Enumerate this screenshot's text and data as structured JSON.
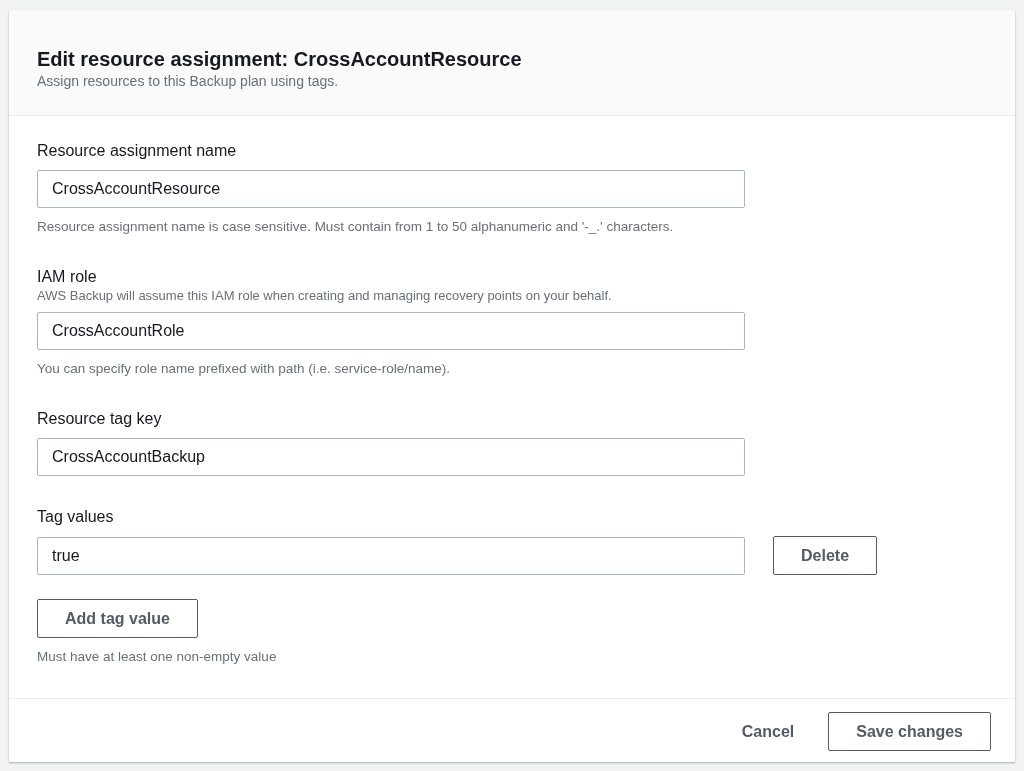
{
  "dialog": {
    "title": "Edit resource assignment: CrossAccountResource",
    "description": "Assign resources to this Backup plan using tags."
  },
  "fields": [
    {
      "label": "Resource assignment name",
      "value": "CrossAccountResource",
      "hint": "Resource assignment name is case sensitive. Must contain from 1 to 50 alphanumeric and '-_.' characters."
    },
    {
      "label": "IAM role",
      "description": "AWS Backup will assume this IAM role when creating and managing recovery points on your behalf.",
      "value": "CrossAccountRole",
      "hint": "You can specify role name prefixed with path (i.e. service-role/name)."
    },
    {
      "label": "Resource tag key",
      "value": "CrossAccountBackup"
    }
  ],
  "tag_values": {
    "label": "Tag values",
    "items": [
      {
        "value": "true",
        "remove_button": "Delete"
      }
    ],
    "add_button": "Add tag value",
    "hint": "Must have at least one non-empty value"
  },
  "footer": {
    "cancel": "Cancel",
    "submit": "Save changes"
  }
}
